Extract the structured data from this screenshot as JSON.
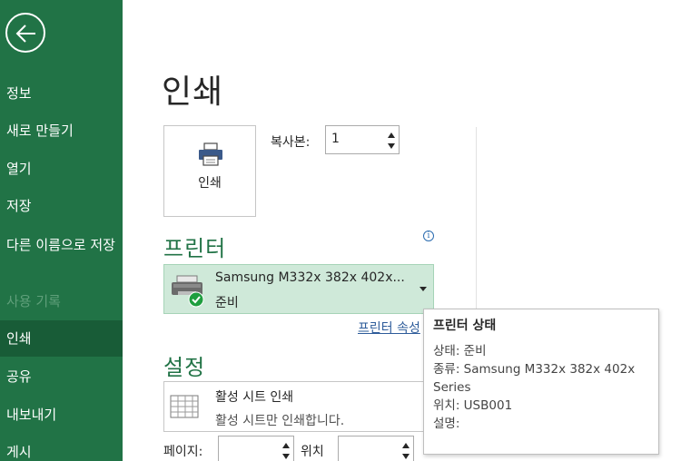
{
  "sidebar": {
    "items": [
      {
        "label": "정보"
      },
      {
        "label": "새로 만들기"
      },
      {
        "label": "열기"
      },
      {
        "label": "저장"
      },
      {
        "label": "다른 이름으로 저장"
      },
      {
        "label": "사용 기록"
      },
      {
        "label": "인쇄"
      },
      {
        "label": "공유"
      },
      {
        "label": "내보내기"
      },
      {
        "label": "게시"
      }
    ],
    "active": "인쇄",
    "disabled": "사용 기록"
  },
  "main": {
    "title": "인쇄",
    "print_button_label": "인쇄",
    "copies": {
      "label": "복사본:",
      "value": "1"
    },
    "printer_section": {
      "title": "프린터",
      "printer_name": "Samsung M332x 382x 402x...",
      "printer_status": "준비",
      "properties_link": "프린터 속성"
    },
    "settings_section": {
      "title": "설정",
      "scope_title": "활성 시트 인쇄",
      "scope_desc": "활성 시트만 인쇄합니다."
    },
    "pages": {
      "label": "페이지:",
      "to_label": "위치",
      "from_value": "",
      "to_value": ""
    }
  },
  "tooltip": {
    "title": "프린터 상태",
    "status_line": "상태: 준비",
    "type_line_1": "종류: Samsung M332x 382x 402x",
    "type_line_2": "Series",
    "location_line": "위치: USB001",
    "comment_line": "설명:"
  },
  "colors": {
    "sidebar_bg": "#217346",
    "sidebar_active": "#185c37",
    "accent": "#217346",
    "selected_printer_bg": "#cfe9d9",
    "link": "#2e5c9a"
  },
  "icons": {
    "back": "back-arrow-icon",
    "printer": "printer-icon",
    "ready_check": "check-circle-icon",
    "sheet": "sheet-grid-icon",
    "info": "info-icon"
  }
}
